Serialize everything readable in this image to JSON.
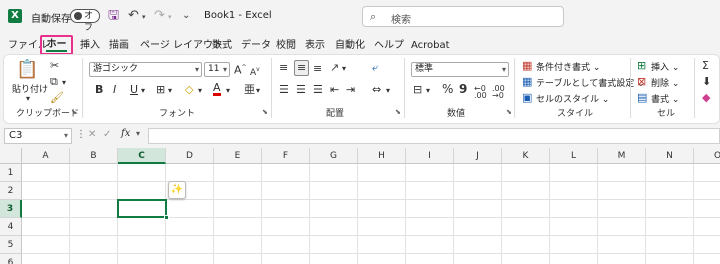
{
  "title_bar": {
    "logo_letter": "X",
    "autosave_label": "自動保存",
    "toggle_state": "オフ",
    "book_title": "Book1  -  Excel",
    "search_placeholder": "検索"
  },
  "tabs": [
    "ファイル",
    "ホーム",
    "挿入",
    "描画",
    "ページ レイアウト",
    "数式",
    "データ",
    "校閲",
    "表示",
    "自動化",
    "ヘルプ",
    "Acrobat"
  ],
  "selected_tab": "ホーム",
  "ribbon": {
    "clipboard": {
      "paste_label": "貼り付け",
      "group_label": "クリップボード"
    },
    "font": {
      "font_name": "游ゴシック",
      "font_size": "11",
      "group_label": "フォント",
      "bold": "B",
      "italic": "I",
      "underline": "U",
      "font_color_letter": "A"
    },
    "alignment": {
      "group_label": "配置"
    },
    "number": {
      "format": "標準",
      "percent": "%",
      "comma": "9",
      "group_label": "数値"
    },
    "styles": {
      "conditional": "条件付き書式",
      "table": "テーブルとして書式設定",
      "cell_styles": "セルのスタイル",
      "group_label": "スタイル"
    },
    "cells": {
      "insert": "挿入",
      "delete": "削除",
      "format": "書式",
      "group_label": "セル"
    },
    "editing": {
      "sum": "Σ"
    }
  },
  "formula_bar": {
    "name_box": "C3",
    "fx": "fx",
    "value": ""
  },
  "grid": {
    "columns": [
      "A",
      "B",
      "C",
      "D",
      "E",
      "F",
      "G",
      "H",
      "I",
      "J",
      "K",
      "L",
      "M",
      "N",
      "O"
    ],
    "rows": [
      "1",
      "2",
      "3",
      "4",
      "5",
      "6"
    ],
    "active_cell": "C3"
  },
  "colors": {
    "accent": "#107c41",
    "tab_highlight": "#e8318a",
    "selected_header": "#d3e6db"
  }
}
